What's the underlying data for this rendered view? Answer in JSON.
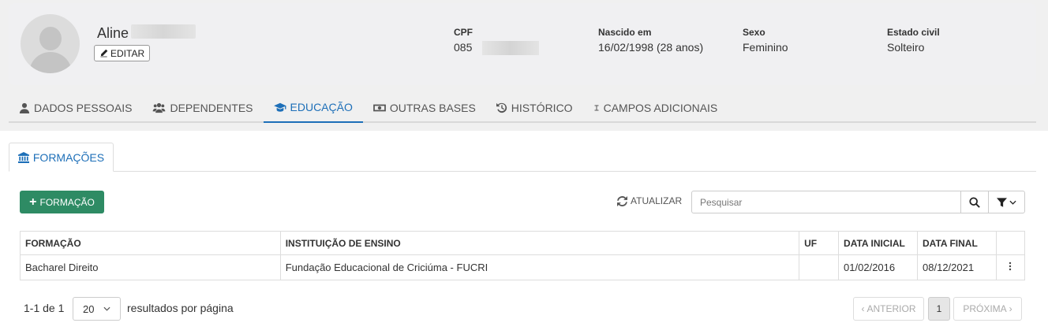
{
  "profile": {
    "name": "Aline",
    "edit_label": "EDITAR",
    "fields": [
      {
        "label": "CPF",
        "value": "085"
      },
      {
        "label": "Nascido em",
        "value": "16/02/1998 (28 anos)"
      },
      {
        "label": "Sexo",
        "value": "Feminino"
      },
      {
        "label": "Estado civil",
        "value": "Solteiro"
      }
    ]
  },
  "tabs": [
    {
      "label": "DADOS PESSOAIS",
      "icon": "user-icon"
    },
    {
      "label": "DEPENDENTES",
      "icon": "users-icon"
    },
    {
      "label": "EDUCAÇÃO",
      "icon": "graduation-cap-icon",
      "active": true
    },
    {
      "label": "OUTRAS BASES",
      "icon": "money-icon"
    },
    {
      "label": "HISTÓRICO",
      "icon": "history-icon"
    },
    {
      "label": "CAMPOS ADICIONAIS",
      "icon": "i-cursor-icon"
    }
  ],
  "subtab": {
    "label": "FORMAÇÕES",
    "icon": "bank-icon"
  },
  "toolbar": {
    "add_label": "FORMAÇÃO",
    "refresh_label": "ATUALIZAR",
    "search_placeholder": "Pesquisar"
  },
  "table": {
    "columns": [
      "FORMAÇÃO",
      "INSTITUIÇÃO DE ENSINO",
      "UF",
      "DATA INICIAL",
      "DATA FINAL"
    ],
    "rows": [
      {
        "formacao": "Bacharel Direito",
        "instituicao": "Fundação Educacional de Criciúma - FUCRI",
        "uf": "",
        "data_inicial": "01/02/2016",
        "data_final": "08/12/2021"
      }
    ]
  },
  "pagination": {
    "range": "1-1 de 1",
    "page_size": "20",
    "per_page_label": "resultados por página",
    "prev_label": "ANTERIOR",
    "current_page": "1",
    "next_label": "PRÓXIMA"
  },
  "colors": {
    "accent": "#1d6fb8",
    "success": "#2e8b64"
  }
}
